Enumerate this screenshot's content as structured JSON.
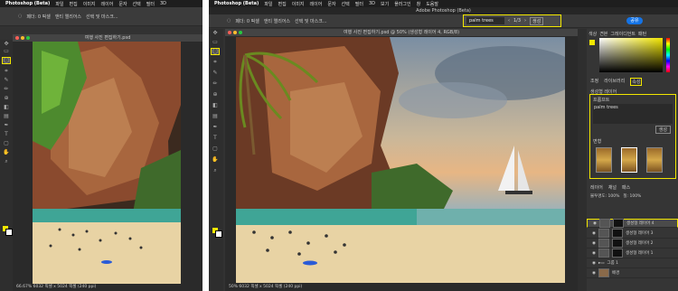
{
  "menubar": {
    "app_title": "Photoshop (Beta)",
    "items": [
      "파일",
      "편집",
      "이미지",
      "레이어",
      "문자",
      "선택",
      "필터",
      "3D",
      "보기",
      "플러그인",
      "창",
      "도움말"
    ]
  },
  "options": {
    "feather_label": "페더: 0 픽셀",
    "antialias_label": "앤티 앨리어스",
    "select_mask_label": "선택 및 마스크..."
  },
  "left_window": {
    "doc_title": "여행 사진 편집하기.psd",
    "status": "66.67%   6032 픽셀 x 5024 픽셀 (240 ppi)"
  },
  "right_window": {
    "app_window_title": "Adobe Photoshop (Beta)",
    "doc_title": "여행 사진 편집하기.psd @ 50% (생성형 레이어 4, RGB/8)",
    "status": "50%   6032 픽셀 x 5024 픽셀 (240 ppi)",
    "genfill_bar": {
      "prompt": "palm trees",
      "counter": "1/3",
      "generate_label": "생성"
    },
    "share_label": "공유"
  },
  "color_panel": {
    "tabs": [
      "색상",
      "견본",
      "그레이디언트",
      "패턴"
    ]
  },
  "properties_panel": {
    "tabs": [
      "조정",
      "라이브러리",
      "속성"
    ],
    "layer_type": "생성형 레이어",
    "prompt_heading": "프롬프트",
    "prompt_value": "palm trees",
    "generate_button": "생성",
    "variations_heading": "변형"
  },
  "layers_panel": {
    "tabs": [
      "레이어",
      "채널",
      "패스"
    ],
    "opacity_label": "불투명도: 100%",
    "fill_label": "칠: 100%",
    "layers": [
      {
        "name": "생성형 레이어 4",
        "selected": true
      },
      {
        "name": "생성형 레이어 3",
        "selected": false
      },
      {
        "name": "생성형 레이어 2",
        "selected": false
      },
      {
        "name": "생성형 레이어 1",
        "selected": false
      },
      {
        "name": "그룹 1",
        "selected": false
      },
      {
        "name": "배경",
        "selected": false
      }
    ]
  },
  "colors": {
    "highlight": "#f3e700",
    "panel_bg": "#323232",
    "accent_blue": "#1473e6"
  }
}
